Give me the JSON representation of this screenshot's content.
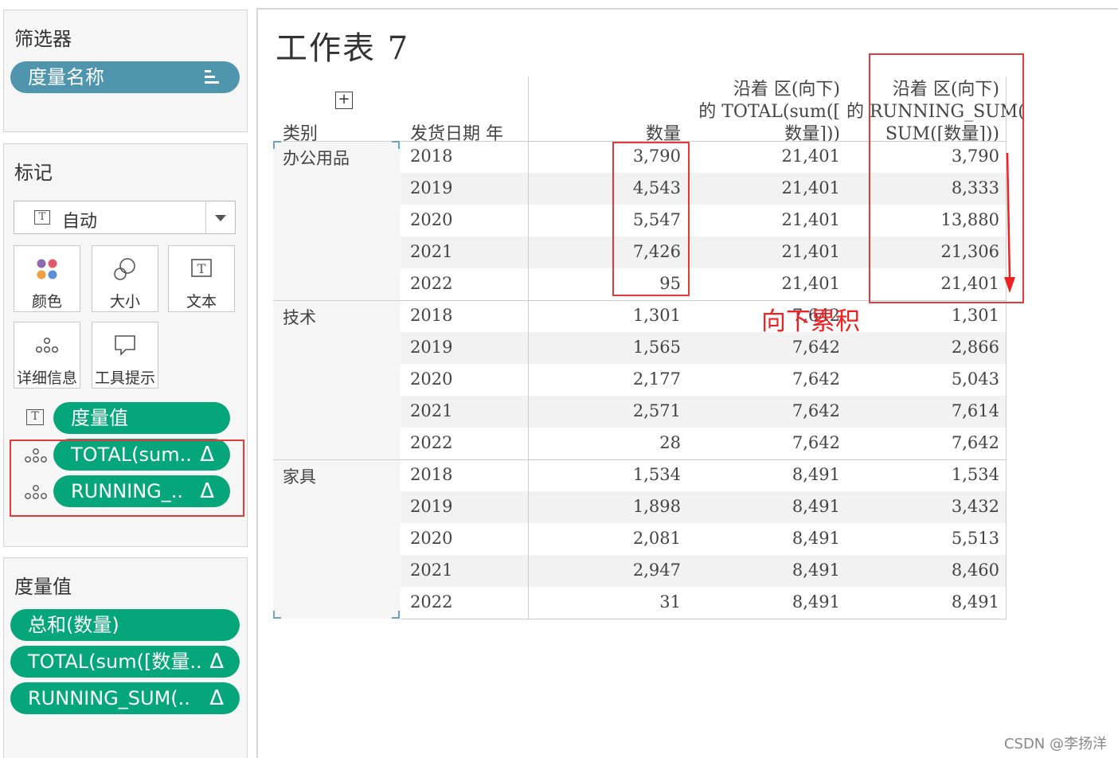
{
  "filters_card": {
    "title": "筛选器",
    "pill": "度量名称"
  },
  "marks_card": {
    "title": "标记",
    "mark_type": "自动",
    "buttons": [
      {
        "label": "颜色",
        "icon": "color-icon"
      },
      {
        "label": "大小",
        "icon": "size-icon"
      },
      {
        "label": "文本",
        "icon": "text-icon"
      },
      {
        "label": "详细信息",
        "icon": "detail-icon"
      },
      {
        "label": "工具提示",
        "icon": "tooltip-icon"
      }
    ],
    "fields": [
      {
        "label": "度量值",
        "icon": "text-icon",
        "delta": ""
      },
      {
        "label": "TOTAL(sum..",
        "icon": "detail-icon",
        "delta": "Δ"
      },
      {
        "label": "RUNNING_..",
        "icon": "detail-icon",
        "delta": "Δ"
      }
    ]
  },
  "measure_values_card": {
    "title": "度量值",
    "fields": [
      {
        "label": "总和(数量)",
        "delta": ""
      },
      {
        "label": "TOTAL(sum([数量..",
        "delta": "Δ"
      },
      {
        "label": "RUNNING_SUM(..",
        "delta": "Δ"
      }
    ]
  },
  "sheet": {
    "title": "工作表 7",
    "headers": {
      "category": "类别",
      "ship_date": "发货日期 年",
      "quantity": "数量",
      "total_line1": "沿着 区(向下)",
      "total_line2": "的 TOTAL(sum([",
      "total_line3": "数量]))",
      "running_line1": "沿着 区(向下)",
      "running_line2": "的 RUNNING_SUM(",
      "running_line3": "SUM([数量]))"
    },
    "groups": [
      {
        "category": "办公用品",
        "rows": [
          {
            "year": "2018",
            "qty": "3,790",
            "total": "21,401",
            "running": "3,790"
          },
          {
            "year": "2019",
            "qty": "4,543",
            "total": "21,401",
            "running": "8,333"
          },
          {
            "year": "2020",
            "qty": "5,547",
            "total": "21,401",
            "running": "13,880"
          },
          {
            "year": "2021",
            "qty": "7,426",
            "total": "21,401",
            "running": "21,306"
          },
          {
            "year": "2022",
            "qty": "95",
            "total": "21,401",
            "running": "21,401"
          }
        ]
      },
      {
        "category": "技术",
        "rows": [
          {
            "year": "2018",
            "qty": "1,301",
            "total": "7,642",
            "running": "1,301"
          },
          {
            "year": "2019",
            "qty": "1,565",
            "total": "7,642",
            "running": "2,866"
          },
          {
            "year": "2020",
            "qty": "2,177",
            "total": "7,642",
            "running": "5,043"
          },
          {
            "year": "2021",
            "qty": "2,571",
            "total": "7,642",
            "running": "7,614"
          },
          {
            "year": "2022",
            "qty": "28",
            "total": "7,642",
            "running": "7,642"
          }
        ]
      },
      {
        "category": "家具",
        "rows": [
          {
            "year": "2018",
            "qty": "1,534",
            "total": "8,491",
            "running": "1,534"
          },
          {
            "year": "2019",
            "qty": "1,898",
            "total": "8,491",
            "running": "3,432"
          },
          {
            "year": "2020",
            "qty": "2,081",
            "total": "8,491",
            "running": "5,513"
          },
          {
            "year": "2021",
            "qty": "2,947",
            "total": "8,491",
            "running": "8,460"
          },
          {
            "year": "2022",
            "qty": "31",
            "total": "8,491",
            "running": "8,491"
          }
        ]
      }
    ]
  },
  "annotation": "向下累积",
  "watermark": "CSDN @李扬洋",
  "colors": {
    "pill_blue": "#4f95ad",
    "pill_green": "#05a67a",
    "annotation_red": "#ee2222",
    "row_stripe": "#f2f2f2"
  }
}
